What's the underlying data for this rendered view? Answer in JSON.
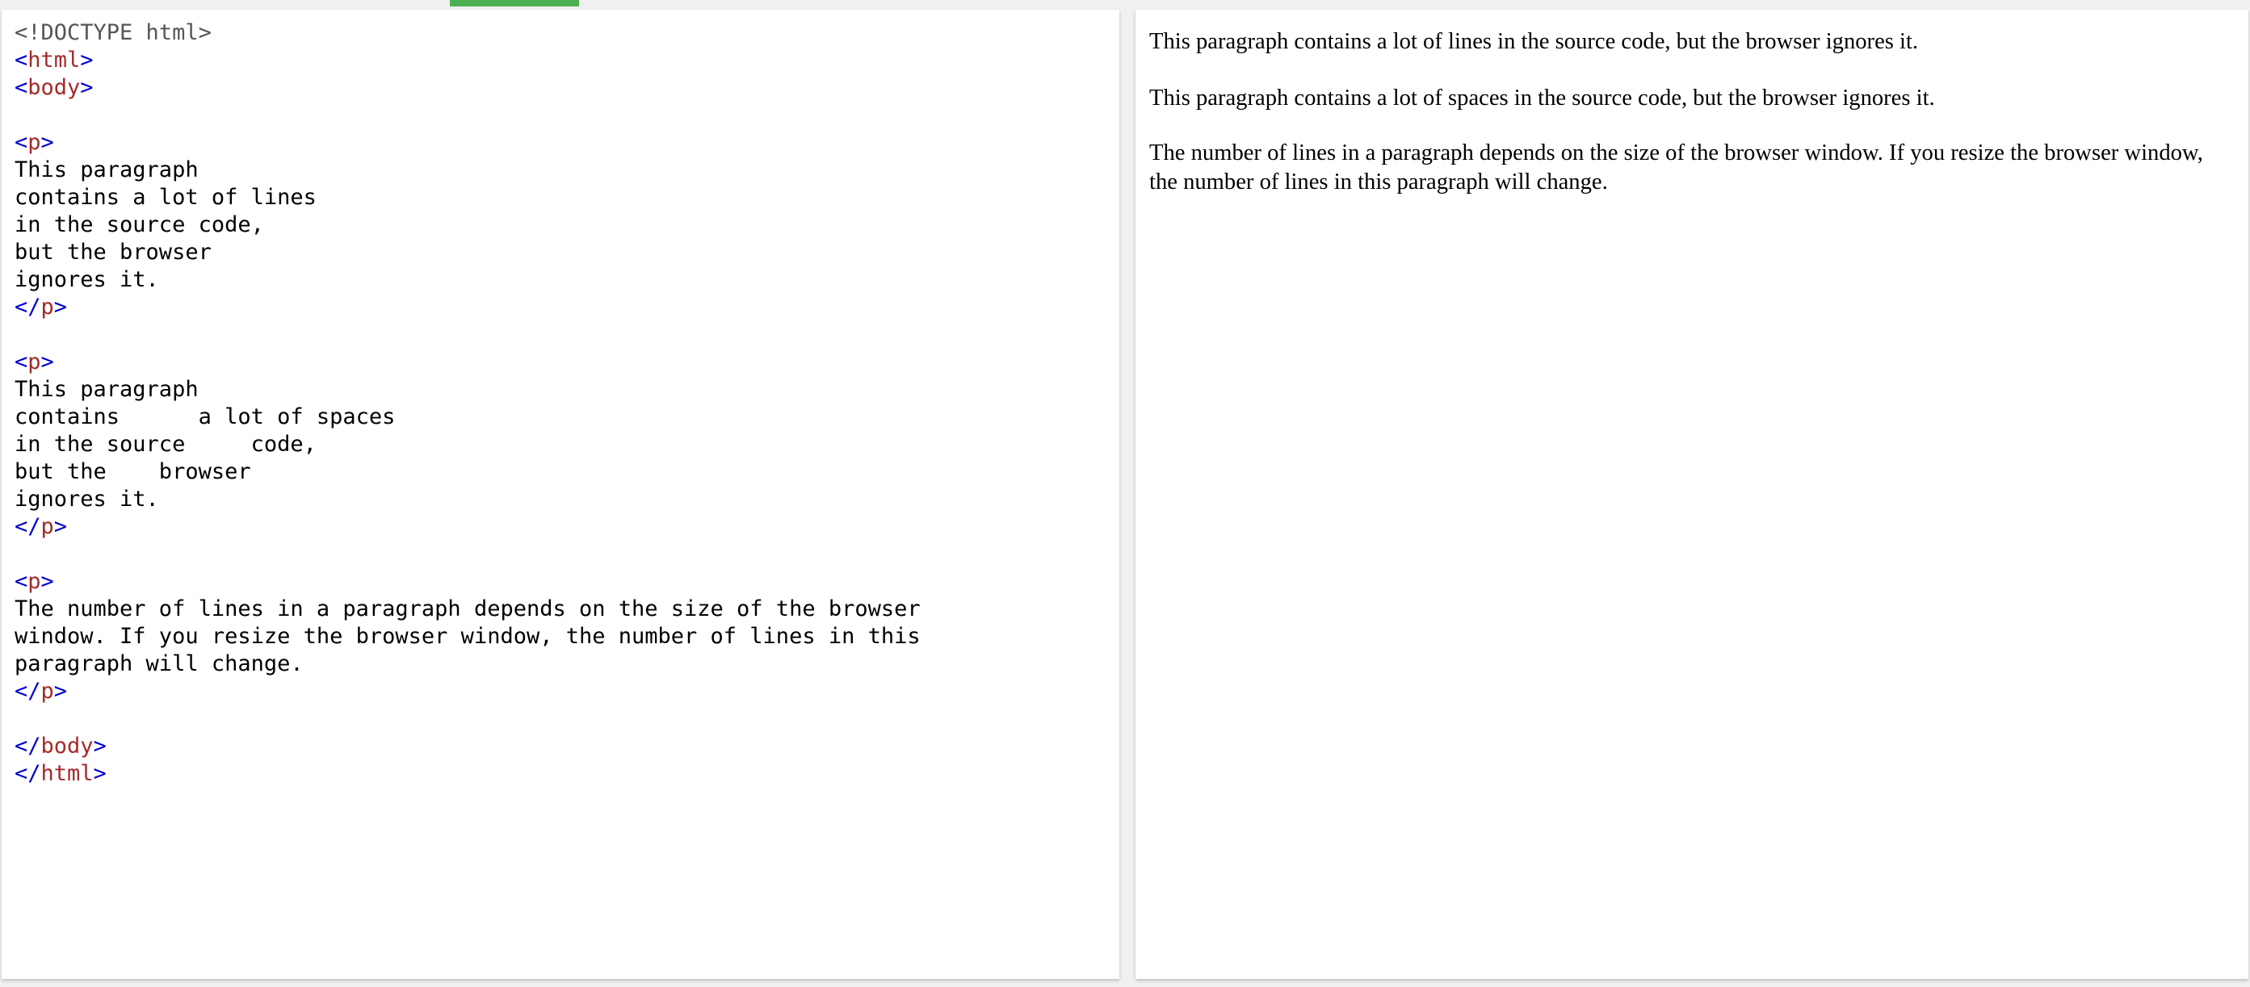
{
  "colors": {
    "accent": "#4caf50",
    "tag_bracket": "#0000cd",
    "tag_name": "#a52a2a",
    "doctype": "#555555"
  },
  "code": {
    "doctype": "<!DOCTYPE html>",
    "tags": {
      "html": "html",
      "body": "body",
      "p": "p"
    },
    "p1_text": "This paragraph\ncontains a lot of lines\nin the source code,\nbut the browser\nignores it.",
    "p2_text": "This paragraph\ncontains      a lot of spaces\nin the source     code,\nbut the    browser\nignores it.",
    "p3_text": "The number of lines in a paragraph depends on the size of the browser\nwindow. If you resize the browser window, the number of lines in this\nparagraph will change."
  },
  "result": {
    "p1": "This paragraph contains a lot of lines in the source code, but the browser ignores it.",
    "p2": "This paragraph contains a lot of spaces in the source code, but the browser ignores it.",
    "p3": "The number of lines in a paragraph depends on the size of the browser window. If you resize the browser window, the number of lines in this paragraph will change."
  }
}
